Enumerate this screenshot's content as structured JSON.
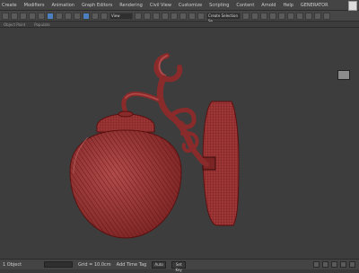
{
  "menubar": {
    "items": [
      "Create",
      "Modifiers",
      "Animation",
      "Graph Editors",
      "Rendering",
      "Civil View",
      "Customize",
      "Scripting",
      "Content",
      "Arnold",
      "Help",
      "GENERATOR"
    ]
  },
  "toolbar": {
    "dropdown1": "View",
    "dropdown2": "Create Selection Se"
  },
  "subbar": {
    "items": [
      "Object Paint",
      "Populate"
    ]
  },
  "statusbar": {
    "left_label": "1 Object",
    "grid_label": "Grid = 10.0cm",
    "add_time_tag": "Add Time Tag",
    "auto_button": "Auto",
    "set_key_button": "Set Key"
  },
  "colors": {
    "model_red": "#a13b3b",
    "wire": "#6a1010",
    "background": "#3d3d3d"
  }
}
